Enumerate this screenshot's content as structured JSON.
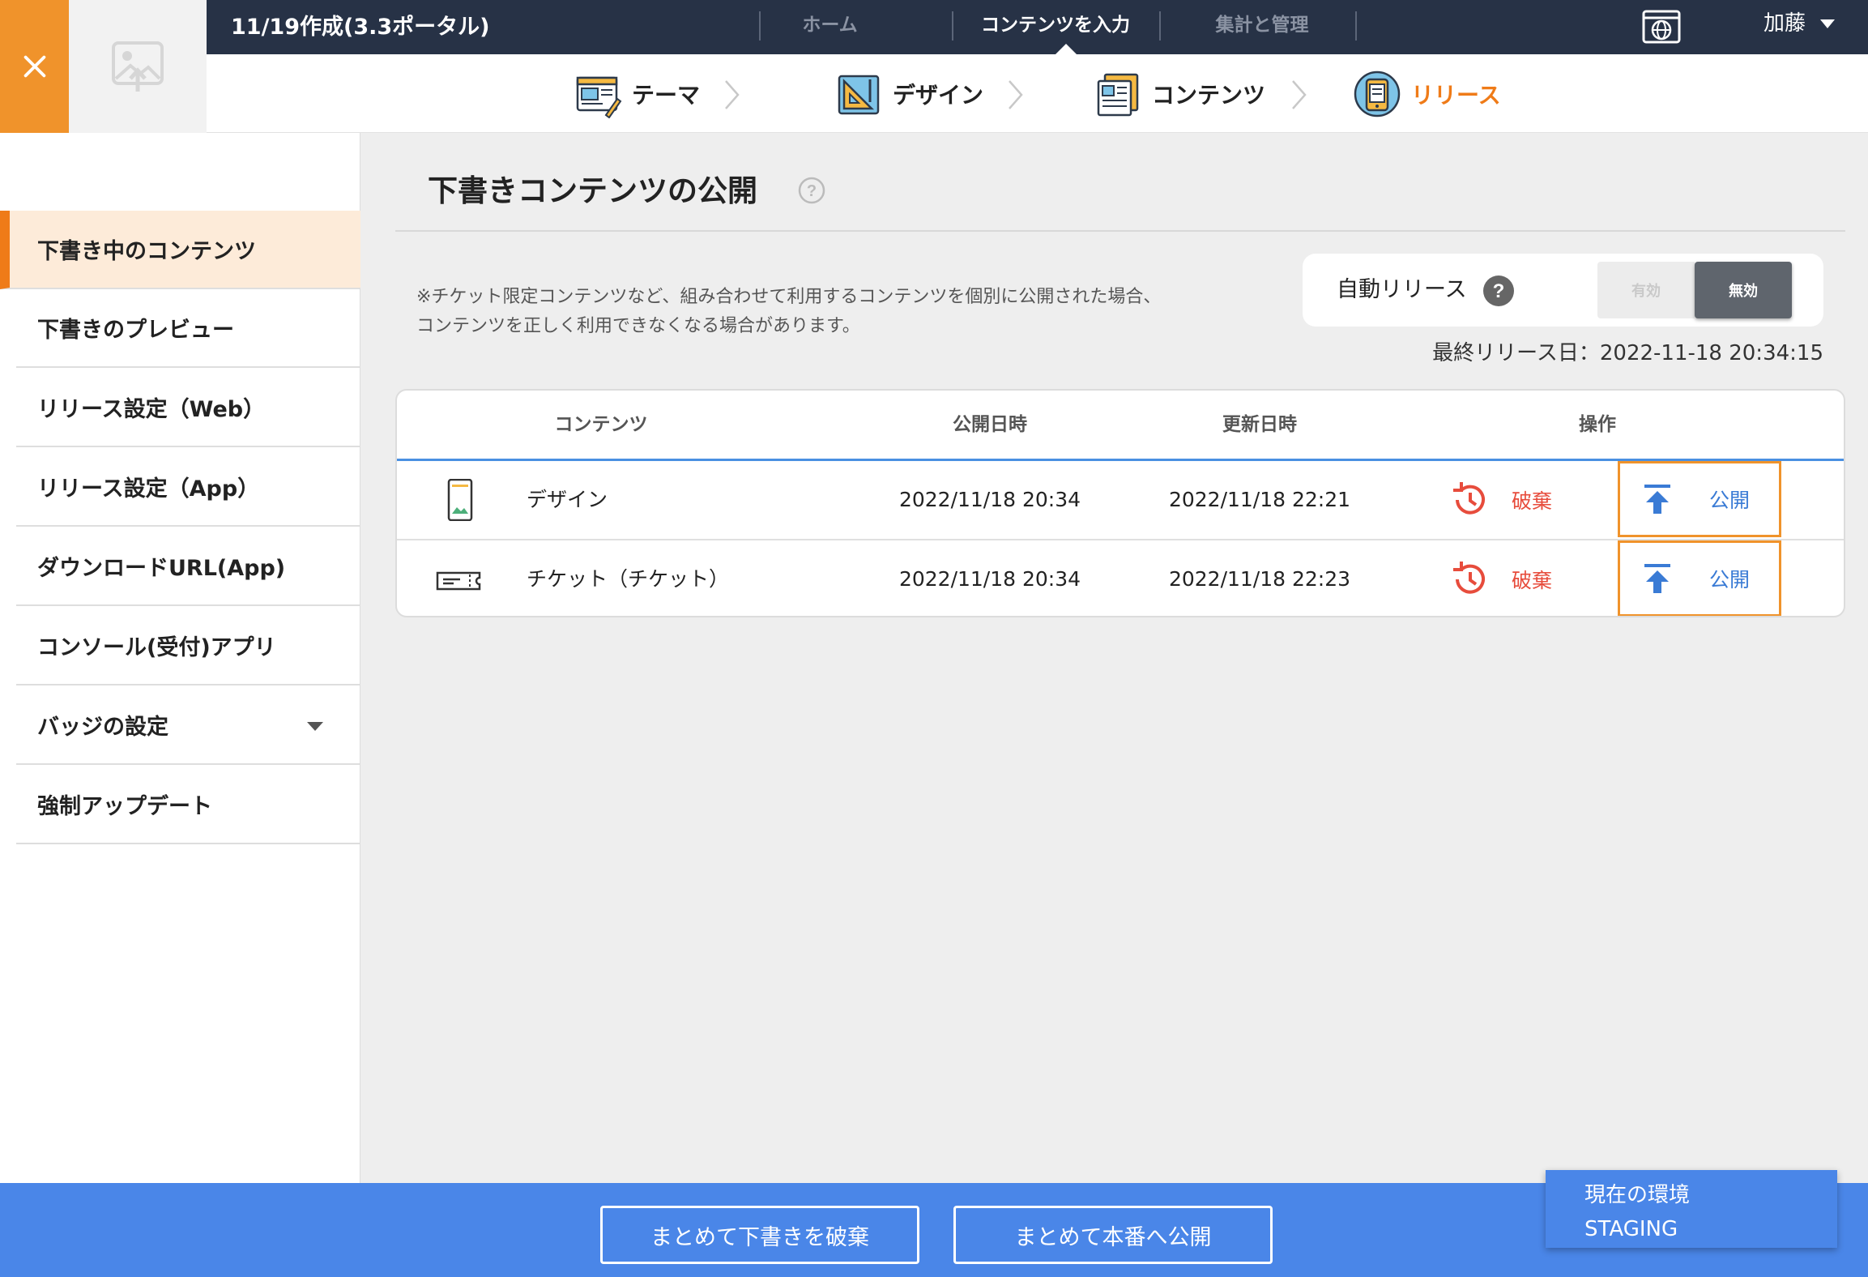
{
  "header": {
    "app_title": "11/19作成(3.3ポータル)",
    "nav": [
      {
        "label": "ホーム",
        "active": false
      },
      {
        "label": "コンテンツを入力",
        "active": true
      },
      {
        "label": "集計と管理",
        "active": false
      }
    ],
    "user_name": "加藤"
  },
  "steps": [
    {
      "label": "テーマ",
      "icon": "theme-icon",
      "active": false
    },
    {
      "label": "デザイン",
      "icon": "design-icon",
      "active": false
    },
    {
      "label": "コンテンツ",
      "icon": "contents-icon",
      "active": false
    },
    {
      "label": "リリース",
      "icon": "release-icon",
      "active": true
    }
  ],
  "sidebar": {
    "items": [
      {
        "label": "下書き中のコンテンツ",
        "active": true
      },
      {
        "label": "下書きのプレビュー"
      },
      {
        "label": "リリース設定（Web）"
      },
      {
        "label": "リリース設定（App）"
      },
      {
        "label": "ダウンロードURL(App)"
      },
      {
        "label": "コンソール(受付)アプリ"
      },
      {
        "label": "バッジの設定",
        "has_dropdown": true
      },
      {
        "label": "強制アップデート"
      }
    ]
  },
  "main": {
    "title": "下書きコンテンツの公開",
    "note_line1": "※チケット限定コンテンツなど、組み合わせて利用するコンテンツを個別に公開された場合、",
    "note_line2": "コンテンツを正しく利用できなくなる場合があります。",
    "auto_release": {
      "label": "自動リリース",
      "on_label": "有効",
      "off_label": "無効",
      "selected": "無効"
    },
    "last_release": "最終リリース日：2022-11-18 20:34:15",
    "table": {
      "headers": [
        "コンテンツ",
        "公開日時",
        "更新日時",
        "操作"
      ],
      "rows": [
        {
          "icon": "phone-design-icon",
          "name": "デザイン",
          "published": "2022/11/18 20:34",
          "updated": "2022/11/18 22:21",
          "discard_label": "破棄",
          "publish_label": "公開"
        },
        {
          "icon": "ticket-icon",
          "name": "チケット（チケット）",
          "published": "2022/11/18 20:34",
          "updated": "2022/11/18 22:23",
          "discard_label": "破棄",
          "publish_label": "公開"
        }
      ]
    }
  },
  "footer": {
    "discard_all": "まとめて下書きを破棄",
    "publish_all": "まとめて本番へ公開"
  },
  "environment": {
    "label": "現在の環境",
    "value": "STAGING"
  },
  "colors": {
    "accent_orange": "#ef7b18",
    "header_navy": "#273246",
    "footer_blue": "#4a86e8",
    "discard_red": "#e74c3c",
    "publish_blue": "#3a7bd5"
  }
}
